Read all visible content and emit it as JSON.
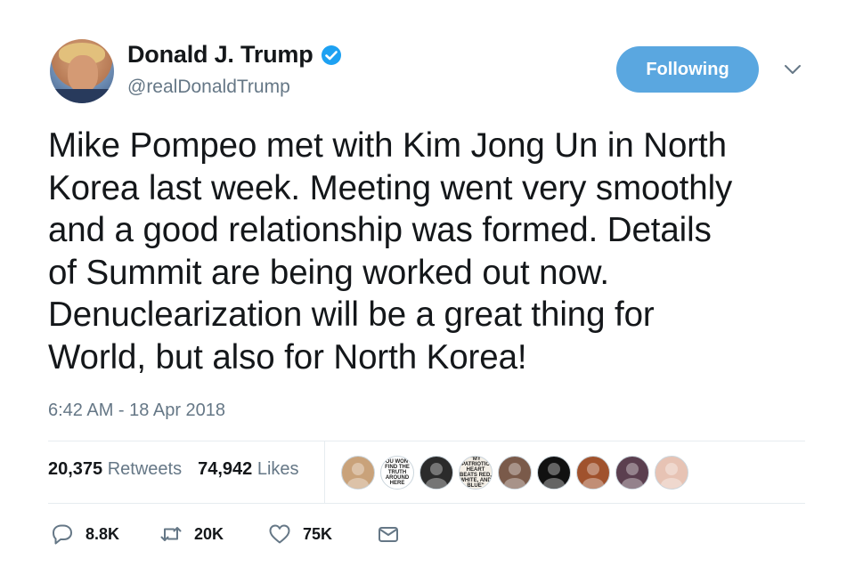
{
  "user": {
    "display_name": "Donald J. Trump",
    "handle": "@realDonaldTrump",
    "verified": true
  },
  "follow_button": {
    "label": "Following",
    "color": "#5aa7e0"
  },
  "tweet": {
    "lines": [
      "Mike Pompeo met with Kim Jong Un in North",
      "Korea last week. Meeting went very smoothly",
      "and a good relationship was formed. Details",
      "of Summit are being worked out now.",
      "Denuclearization will be a great thing for",
      "World, but also for North Korea!"
    ],
    "timestamp": "6:42 AM - 18 Apr 2018"
  },
  "stats": {
    "retweets_count": "20,375",
    "retweets_label": "Retweets",
    "likes_count": "74,942",
    "likes_label": "Likes"
  },
  "liker_avatars": [
    {
      "icon": "person-avatar",
      "bg": "#c9a27a"
    },
    {
      "icon": "text-avatar",
      "bg": "#ffffff",
      "text": "YOU WON'T FIND THE TRUTH AROUND HERE"
    },
    {
      "icon": "person-avatar",
      "bg": "#2b2b2b"
    },
    {
      "icon": "text-avatar",
      "bg": "#f4efe6",
      "text": "\"MY PATRIOTIC HEART BEATS RED, WHITE, AND BLUE\""
    },
    {
      "icon": "person-avatar",
      "bg": "#7a5a4a"
    },
    {
      "icon": "person-avatar",
      "bg": "#111111"
    },
    {
      "icon": "person-avatar",
      "bg": "#a0522d"
    },
    {
      "icon": "person-avatar",
      "bg": "#5b3f4f"
    },
    {
      "icon": "person-avatar",
      "bg": "#e7c3b4"
    }
  ],
  "actions": {
    "reply_count": "8.8K",
    "retweet_count": "20K",
    "like_count": "75K"
  },
  "colors": {
    "text_primary": "#14171a",
    "text_secondary": "#657786",
    "accent": "#1da1f2",
    "divider": "#e6ecf0"
  }
}
